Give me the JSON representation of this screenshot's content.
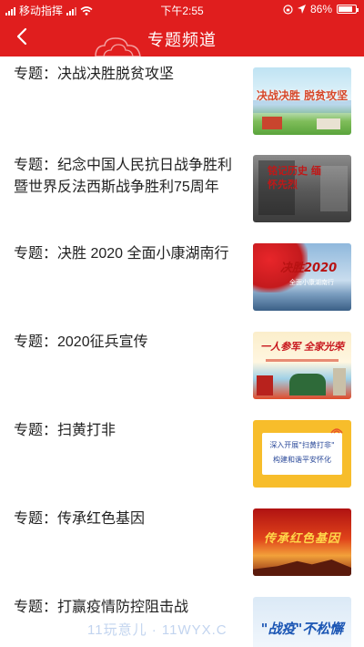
{
  "status_bar": {
    "carrier": "移动指挥",
    "time": "下午2:55",
    "battery": "86%"
  },
  "nav": {
    "title": "专题频道",
    "back_icon": "chevron-left-icon"
  },
  "topics": [
    {
      "title": "专题：决战决胜脱贫攻坚",
      "thumb_text": "决战决胜 脱贫攻坚"
    },
    {
      "title": "专题：纪念中国人民抗日战争胜利暨世界反法西斯战争胜利75周年",
      "thumb_text": "铭记历史 缅怀先烈"
    },
    {
      "title": "专题：决胜 2020 全面小康湖南行",
      "thumb_text": "决胜2020",
      "thumb_sub": "全面小康湖南行"
    },
    {
      "title": "专题：2020征兵宣传",
      "thumb_text": "一人参军 全家光荣"
    },
    {
      "title": "专题：扫黄打非",
      "thumb_text": "深入开展\"扫黄打非\"",
      "thumb_sub": "构建和谐平安怀化"
    },
    {
      "title": "专题：传承红色基因",
      "thumb_text": "传承红色基因"
    },
    {
      "title": "专题：打赢疫情防控阻击战",
      "thumb_text": "\"战疫\"不松懈"
    }
  ],
  "watermark": "11玩意儿 · 11WYX.C"
}
